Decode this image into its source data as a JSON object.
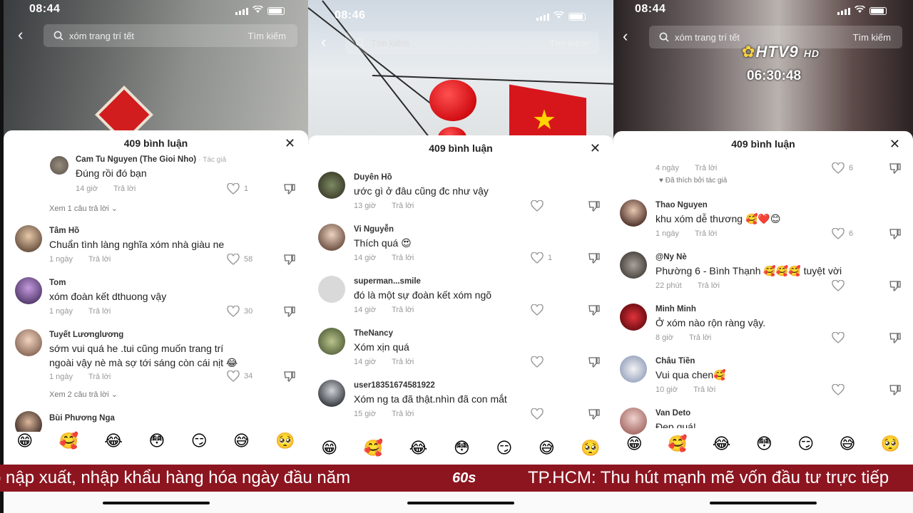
{
  "colors": {
    "ticker_bg": "#8c1520",
    "like_gray": "#999999",
    "flag_red": "#d7161c",
    "flag_star": "#ffd400"
  },
  "panels": [
    {
      "time": "08:44",
      "search": {
        "query": "xóm trang trí tết",
        "button": "Tìm kiếm"
      },
      "comment_count": "409 bình luận",
      "comments": [
        {
          "name": "Cam Tu Nguyen (The Gioi Nho)",
          "badge": "· Tác giả",
          "text": "Đúng rồi đó bạn",
          "age": "14 giờ",
          "reply": "Trả lời",
          "likes": "1"
        },
        {
          "name": "Tâm Hồ",
          "text": "Chuẩn tình làng nghĩa xóm nhà giàu ne",
          "age": "1 ngày",
          "reply": "Trả lời",
          "likes": "58"
        },
        {
          "name": "Tom",
          "text": "xóm đoàn kết dthuong vậy",
          "age": "1 ngày",
          "reply": "Trả lời",
          "likes": "30"
        },
        {
          "name": "Tuyết Lươnglương",
          "text": "sớm vui quá he .tui cũng muốn trang trí",
          "text2": "ngoài vậy nè mà sợ tới sáng còn cái nịt 😂",
          "age": "1 ngày",
          "reply": "Trả lời",
          "likes": "34"
        },
        {
          "name": "Bùi Phương Nga"
        }
      ],
      "view_replies_1": "Xem 1 câu trả lời",
      "view_replies_2": "Xem 2 câu trả lời",
      "emojis": [
        "😁",
        "🥰",
        "😂",
        "😳",
        "😏",
        "😅",
        "🥺"
      ]
    },
    {
      "time": "08:46",
      "search": {
        "placeholder": "Tìm kiếm",
        "button": "Tìm kiếm"
      },
      "comment_count": "409 bình luận",
      "comments": [
        {
          "name": "Duyên Hồ",
          "text": "ước gì ở đâu cũng đc như vậy",
          "age": "13 giờ",
          "reply": "Trả lời",
          "likes": ""
        },
        {
          "name": "Vi Nguyễn",
          "text": "Thích quá 😍",
          "age": "14 giờ",
          "reply": "Trả lời",
          "likes": "1"
        },
        {
          "name": "superman...smile",
          "text": "đó là một sự đoàn kết xóm ngõ",
          "age": "14 giờ",
          "reply": "Trả lời",
          "likes": ""
        },
        {
          "name": "TheNancy",
          "text": "Xóm xịn quá",
          "age": "14 giờ",
          "reply": "Trả lời",
          "likes": ""
        },
        {
          "name": "user18351674581922",
          "text": "Xóm ng ta đã thật.nhìn đã con mắt",
          "age": "15 giờ",
          "reply": "Trả lời",
          "likes": ""
        }
      ],
      "emojis": [
        "😁",
        "🥰",
        "😂",
        "😳",
        "😏",
        "😅",
        "🥺"
      ]
    },
    {
      "time": "08:44",
      "search": {
        "query": "xóm trang trí tết",
        "button": "Tìm kiếm"
      },
      "channel_logo": "HTV9",
      "channel_logo_hd": "HD",
      "clock": "06:30:48",
      "comment_count": "409 bình luận",
      "top_meta": {
        "age": "4 ngày",
        "reply": "Trả lời",
        "likes": "6",
        "liked_by_author": "Đã thích bởi tác giả"
      },
      "comments": [
        {
          "name": "Thao Nguyen",
          "text": "khu xóm dễ thương 🥰❤️😊",
          "age": "1 ngày",
          "reply": "Trả lời",
          "likes": "6"
        },
        {
          "name": "@Ny Nè",
          "text": "Phường 6 - Bình Thạnh 🥰🥰🥰 tuyệt vời",
          "age": "22 phút",
          "reply": "Trả lời",
          "likes": ""
        },
        {
          "name": "Minh Minh",
          "text": "Ở xóm nào rộn ràng vậy.",
          "age": "8 giờ",
          "reply": "Trả lời",
          "likes": ""
        },
        {
          "name": "Châu Tiền",
          "text": "Vui qua chen🥰",
          "age": "10 giờ",
          "reply": "Trả lời",
          "likes": ""
        },
        {
          "name": "Van Deto",
          "text": "Đẹp quá!"
        }
      ],
      "emojis": [
        "😁",
        "🥰",
        "😂",
        "😳",
        "😏",
        "😅",
        "🥺"
      ]
    }
  ],
  "ticker": {
    "left_text": "p nập xuất, nhập khẩu hàng hóa ngày đầu năm",
    "logo": "60s",
    "right_text": "TP.HCM: Thu hút mạnh mẽ vốn đầu tư trực tiếp"
  }
}
